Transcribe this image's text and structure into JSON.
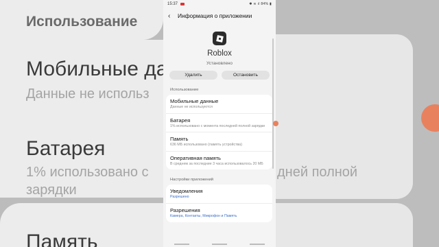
{
  "background": {
    "heading": "Использование",
    "left_lines": [
      {
        "text": "Мобильные да",
        "kind": "big"
      },
      {
        "text": "Данные не использ",
        "kind": "sub"
      },
      {
        "text": "Батарея",
        "kind": "big"
      },
      {
        "text": "1% использовано с",
        "kind": "sub"
      },
      {
        "text": "зарядки",
        "kind": "sub"
      },
      {
        "text": "Память",
        "kind": "big"
      }
    ],
    "right_lines": [
      "дней полной"
    ]
  },
  "status_bar": {
    "time": "15:37",
    "icons": "✱ ≋ ıl 84% ▮"
  },
  "app_bar": {
    "back_icon": "‹",
    "title": "Информация о приложении"
  },
  "app": {
    "icon": "roblox-logo",
    "name": "Roblox",
    "state": "Установлено"
  },
  "buttons": {
    "uninstall": "Удалить",
    "stop": "Остановить"
  },
  "usage": {
    "label": "Использование",
    "items": [
      {
        "title": "Мобильные данные",
        "sub": "Данные не используются"
      },
      {
        "title": "Батарея",
        "sub": "1% использовано с момента последней полной зарядки"
      },
      {
        "title": "Память",
        "sub": "636 МБ использовано (память устройства)"
      },
      {
        "title": "Оперативная память",
        "sub": "В среднем за последние 3 часа использовалось 20 МБ"
      }
    ]
  },
  "settings": {
    "label": "Настройки приложений",
    "items": [
      {
        "title": "Уведомления",
        "sub": "Разрешено"
      },
      {
        "title": "Разрешения",
        "sub": "Камера, Контакты, Микрофон и Память"
      }
    ]
  },
  "colors": {
    "link": "#3a6ec8",
    "accent_orange": "#e8825e"
  }
}
